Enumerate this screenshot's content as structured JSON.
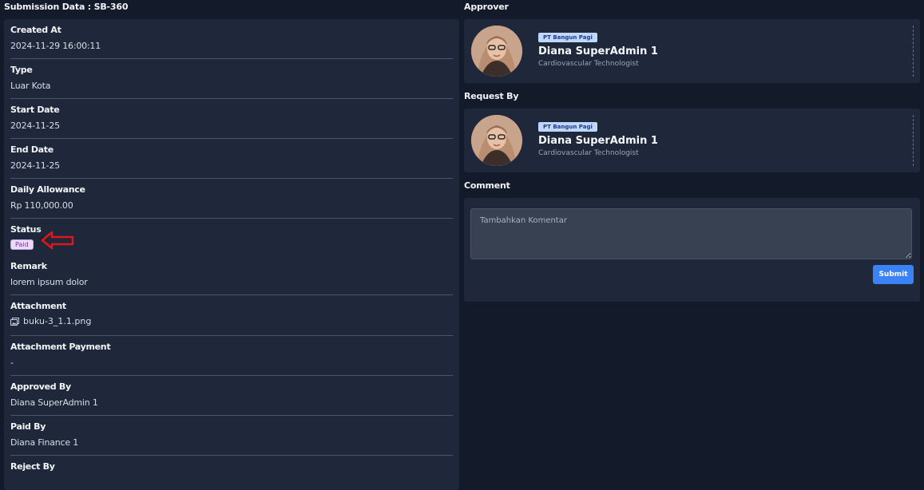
{
  "page": {
    "submission_title": "Submission Data : SB-360",
    "approver_title": "Approver",
    "request_by_title": "Request By",
    "comment_title": "Comment"
  },
  "fields": {
    "created_at": {
      "label": "Created At",
      "value": "2024-11-29 16:00:11"
    },
    "type": {
      "label": "Type",
      "value": "Luar Kota"
    },
    "start_date": {
      "label": "Start Date",
      "value": "2024-11-25"
    },
    "end_date": {
      "label": "End Date",
      "value": "2024-11-25"
    },
    "daily_allowance": {
      "label": "Daily Allowance",
      "value": "Rp 110,000.00"
    },
    "status": {
      "label": "Status",
      "value": "Paid"
    },
    "remark": {
      "label": "Remark",
      "value": "lorem ipsum dolor"
    },
    "attachment": {
      "label": "Attachment",
      "value": "buku-3_1.1.png"
    },
    "attachment_payment": {
      "label": "Attachment Payment",
      "value": "-"
    },
    "approved_by": {
      "label": "Approved By",
      "value": "Diana SuperAdmin 1"
    },
    "paid_by": {
      "label": "Paid By",
      "value": "Diana Finance 1"
    },
    "reject_by": {
      "label": "Reject By",
      "value": ""
    }
  },
  "approver": {
    "company": "PT Bangun Pagi",
    "name": "Diana SuperAdmin 1",
    "role": "Cardiovascular Technologist"
  },
  "request_by": {
    "company": "PT Bangun Pagi",
    "name": "Diana SuperAdmin 1",
    "role": "Cardiovascular Technologist"
  },
  "comment": {
    "placeholder": "Tambahkan Komentar",
    "submit_label": "Submit"
  },
  "colors": {
    "background": "#131a29",
    "panel": "#1e283a",
    "accent": "#3b82f6",
    "paid_badge": "#ead9f7",
    "arrow": "#e0161b"
  },
  "icons": {
    "attachment": "image-file-icon",
    "status_pointer": "red-arrow-annotation"
  }
}
